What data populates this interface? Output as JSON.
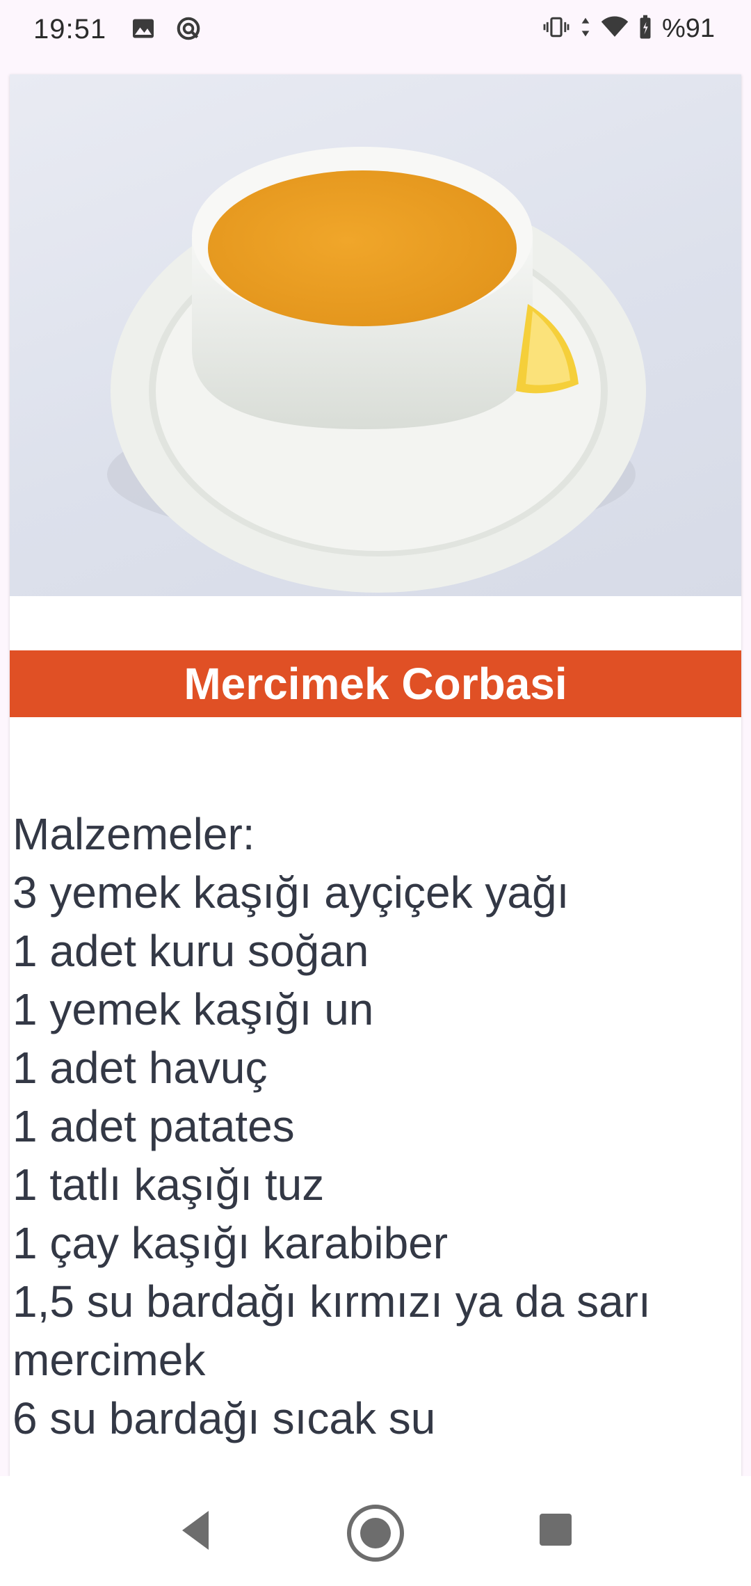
{
  "status_bar": {
    "time": "19:51",
    "battery": "%91",
    "icons": [
      "image-icon",
      "data-saver-icon",
      "vibrate-icon",
      "data-arrows-icon",
      "wifi-icon",
      "battery-icon"
    ]
  },
  "recipe": {
    "image_alt": "lentil-soup-photo",
    "title": "Mercimek Corbasi",
    "ingredients": [
      "Malzemeler:",
      "3 yemek kaşığı ayçiçek yağı",
      "1 adet kuru soğan",
      "1 yemek kaşığı un",
      "1 adet havuç",
      "1 adet patates",
      "1 tatlı kaşığı tuz",
      "1 çay kaşığı karabiber",
      "1,5 su bardağı kırmızı ya da sarı mercimek",
      "6 su bardağı sıcak su"
    ],
    "accent_color": "#e05025"
  },
  "nav": {
    "buttons": [
      "back-icon",
      "home-icon",
      "recents-icon"
    ]
  }
}
